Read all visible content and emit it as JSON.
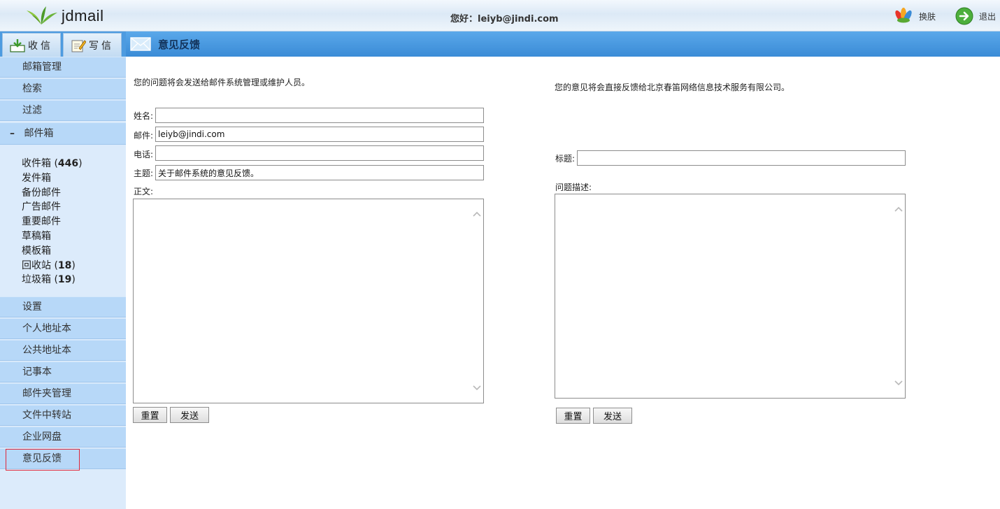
{
  "header": {
    "logo_text": "jdmail",
    "greeting": "您好：leiyb@jindi.com",
    "skin_label": "换肤",
    "logout_label": "退出"
  },
  "sidebar": {
    "tabs": [
      {
        "label": "收信",
        "icon": "inbox-download-icon"
      },
      {
        "label": "写信",
        "icon": "compose-note-icon"
      }
    ],
    "top_items": [
      "邮箱管理",
      "检索",
      "过滤"
    ],
    "mailbox_group": {
      "label": "邮件箱",
      "toggle": "–"
    },
    "folders": [
      {
        "name": "收件箱",
        "count": "446"
      },
      {
        "name": "发件箱",
        "count": ""
      },
      {
        "name": "备份邮件",
        "count": ""
      },
      {
        "name": "广告邮件",
        "count": ""
      },
      {
        "name": "重要邮件",
        "count": ""
      },
      {
        "name": "草稿箱",
        "count": ""
      },
      {
        "name": "模板箱",
        "count": ""
      },
      {
        "name": "回收站",
        "count": "18"
      },
      {
        "name": "垃圾箱",
        "count": "19"
      }
    ],
    "bottom_items": [
      "设置",
      "个人地址本",
      "公共地址本",
      "记事本",
      "邮件夹管理",
      "文件中转站",
      "企业网盘",
      "意见反馈"
    ],
    "active_item": "意见反馈"
  },
  "content": {
    "title": "意见反馈",
    "left_form": {
      "note": "您的问题将会发送给邮件系统管理或维护人员。",
      "name_label": "姓名:",
      "name_value": "",
      "email_label": "邮件:",
      "email_value": "leiyb@jindi.com",
      "phone_label": "电话:",
      "phone_value": "",
      "subject_label": "主题:",
      "subject_value": "关于邮件系统的意见反馈。",
      "body_label": "正文:",
      "reset_label": "重置",
      "send_label": "发送"
    },
    "right_form": {
      "note": "您的意见将会直接反馈给北京春笛网络信息技术服务有限公司。",
      "title_label": "标题:",
      "title_value": "",
      "desc_label": "问题描述:",
      "reset_label": "重置",
      "send_label": "发送"
    }
  },
  "colors": {
    "header_blue": "#3a8bd6",
    "sidebar_bg": "#dcebfb",
    "nav_item_bg": "#b7d8f8",
    "active_outline": "#e0283a"
  }
}
